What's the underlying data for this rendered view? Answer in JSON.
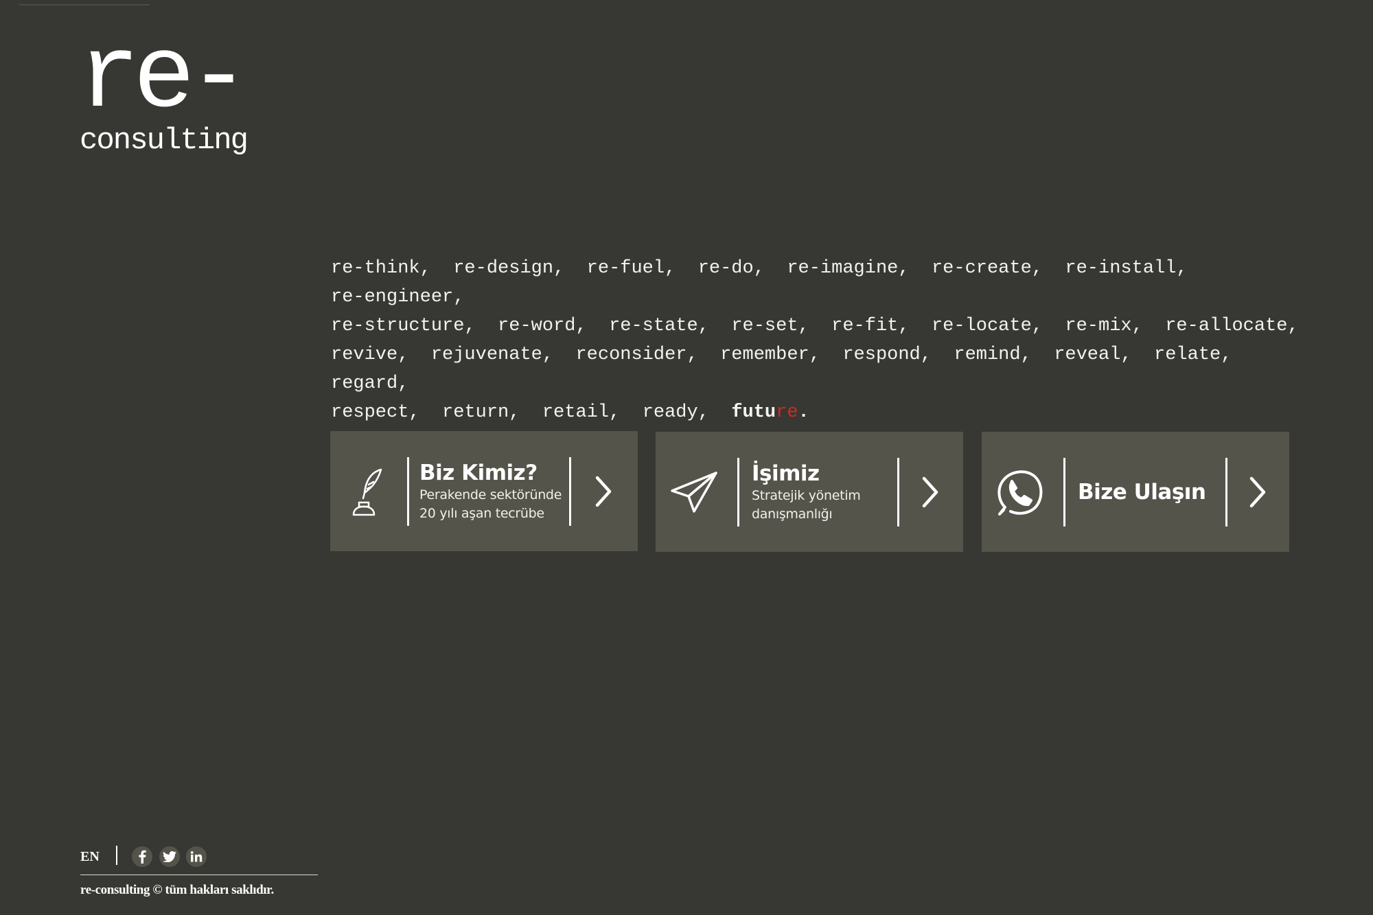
{
  "logo": {
    "main": "re-",
    "sub": "consulting"
  },
  "tagline": {
    "words": [
      "re-think",
      "re-design",
      "re-fuel",
      "re-do",
      "re-imagine",
      "re-create",
      "re-install",
      "re-engineer",
      "re-structure",
      "re-word",
      "re-state",
      "re-set",
      "re-fit",
      "re-locate",
      "re-mix",
      "re-allocate",
      "revive",
      "rejuvenate",
      "reconsider",
      "remember",
      "respond",
      "remind",
      "reveal",
      "relate",
      "regard",
      "respect",
      "return",
      "retail",
      "ready"
    ],
    "final_word_prefix": "futu",
    "final_word_accent": "re",
    "final_punct": ".",
    "accent_color": "#d3291f"
  },
  "cards": [
    {
      "icon": "quill-inkwell-icon",
      "title": "Biz Kimiz?",
      "subtitle_line1": "Perakende sektöründe",
      "subtitle_line2": "20 yılı aşan tecrübe"
    },
    {
      "icon": "paper-plane-icon",
      "title": "İşimiz",
      "subtitle_line1": "Stratejik yönetim",
      "subtitle_line2": "danışmanlığı"
    },
    {
      "icon": "phone-icon",
      "title": "Bize Ulaşın",
      "subtitle_line1": "",
      "subtitle_line2": ""
    }
  ],
  "footer": {
    "language": "EN",
    "social": [
      "facebook-icon",
      "twitter-icon",
      "linkedin-icon"
    ],
    "copyright": "re-consulting © tüm hakları saklıdır."
  },
  "colors": {
    "background": "#373833",
    "card": "#55544b",
    "text": "#ffffff"
  }
}
